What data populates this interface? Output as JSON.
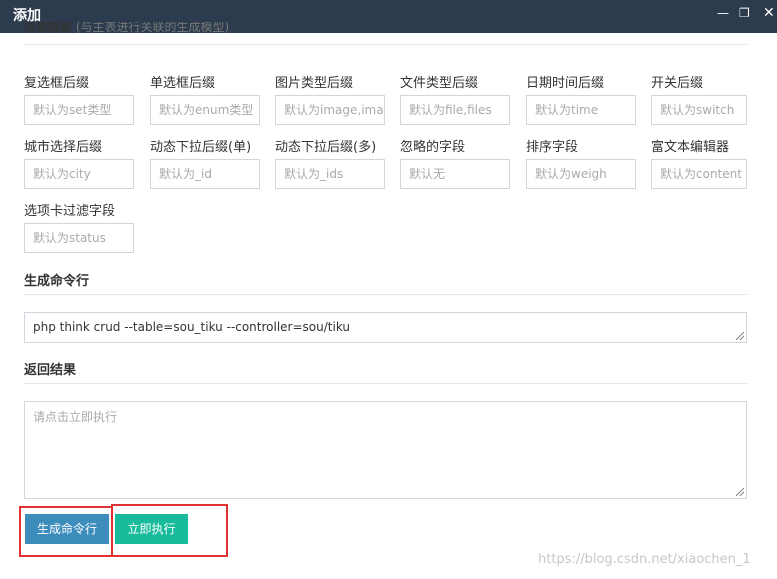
{
  "window": {
    "title": "添加",
    "minimize": "—",
    "maximize": "❐",
    "close": "✕"
  },
  "cut_header": {
    "label": "关联模型",
    "hint": "(与主表进行关联的生成模型)"
  },
  "fields": [
    {
      "label": "复选框后缀",
      "placeholder": "默认为set类型"
    },
    {
      "label": "单选框后缀",
      "placeholder": "默认为enum类型"
    },
    {
      "label": "图片类型后缀",
      "placeholder": "默认为image,images"
    },
    {
      "label": "文件类型后缀",
      "placeholder": "默认为file,files"
    },
    {
      "label": "日期时间后缀",
      "placeholder": "默认为time"
    },
    {
      "label": "开关后缀",
      "placeholder": "默认为switch"
    },
    {
      "label": "城市选择后缀",
      "placeholder": "默认为city"
    },
    {
      "label": "动态下拉后缀(单)",
      "placeholder": "默认为_id"
    },
    {
      "label": "动态下拉后缀(多)",
      "placeholder": "默认为_ids"
    },
    {
      "label": "忽略的字段",
      "placeholder": "默认无"
    },
    {
      "label": "排序字段",
      "placeholder": "默认为weigh"
    },
    {
      "label": "富文本编辑器",
      "placeholder": "默认为content"
    },
    {
      "label": "选项卡过滤字段",
      "placeholder": "默认为status"
    }
  ],
  "command": {
    "title": "生成命令行",
    "value": "php think crud --table=sou_tiku --controller=sou/tiku"
  },
  "result": {
    "title": "返回结果",
    "placeholder": "请点击立即执行"
  },
  "buttons": {
    "generate": "生成命令行",
    "execute": "立即执行"
  },
  "colors": {
    "titlebar": "#2c3b4e",
    "primary": "#3c8dbc",
    "success": "#18bc9c",
    "highlight": "#e03232"
  },
  "watermark": "https://blog.csdn.net/xiaochen_1"
}
